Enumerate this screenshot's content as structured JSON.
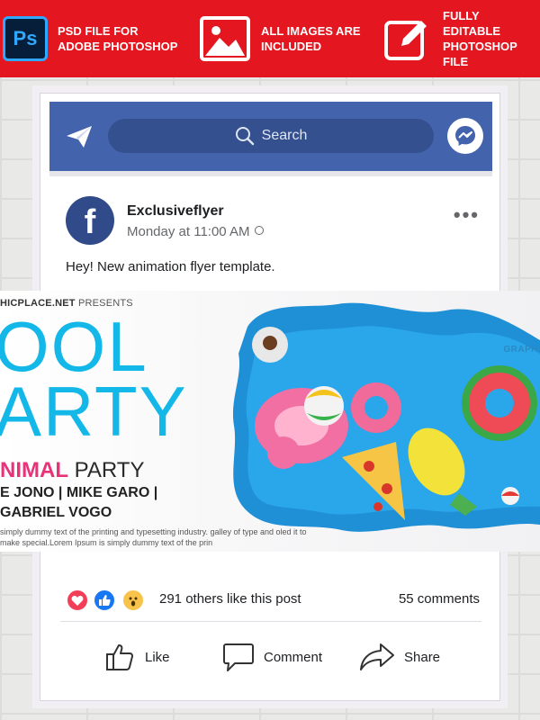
{
  "banner": {
    "feature1": {
      "line1": "PSD FILE FOR",
      "line2": "ADOBE PHOTOSHOP",
      "icon": "photoshop-icon",
      "badge": "Ps"
    },
    "feature2": {
      "line1": "ALL IMAGES ARE",
      "line2": "INCLUDED",
      "icon": "image-icon"
    },
    "feature3": {
      "line1": "FULLY EDITABLE",
      "line2": "PHOTOSHOP FILE",
      "icon": "edit-icon"
    }
  },
  "navbar": {
    "search_placeholder": "Search",
    "left_icon": "send-icon",
    "right_icon": "messenger-icon"
  },
  "post": {
    "author": "Exclusiveflyer",
    "timestamp": "Monday at 11:00 AM",
    "text": "Hey! New animation flyer template.",
    "avatar_letter": "f"
  },
  "flyer": {
    "presents_site": "HICPLACE.NET",
    "presents_word": "PRESENTS",
    "title_line1": "OOL",
    "title_line2": "ARTY",
    "sub_pink": "NIMAL",
    "sub_rest": "PARTY",
    "names_line1": "E JONO | MIKE GARO |",
    "names_line2": "GABRIEL VOGO",
    "lorem": "simply dummy text of the printing and typesetting industry. galley of type and oled it to make special.Lorem Ipsum is simply dummy text of the prin",
    "corner_text": "GRAPH"
  },
  "stats": {
    "likes": "291 others like this post",
    "comments": "55 comments"
  },
  "actions": {
    "like": "Like",
    "comment": "Comment",
    "share": "Share"
  },
  "colors": {
    "banner_red": "#e4161f",
    "facebook_blue": "#4363ad",
    "flyer_cyan": "#14b8e8",
    "flyer_pink": "#e8327a"
  }
}
